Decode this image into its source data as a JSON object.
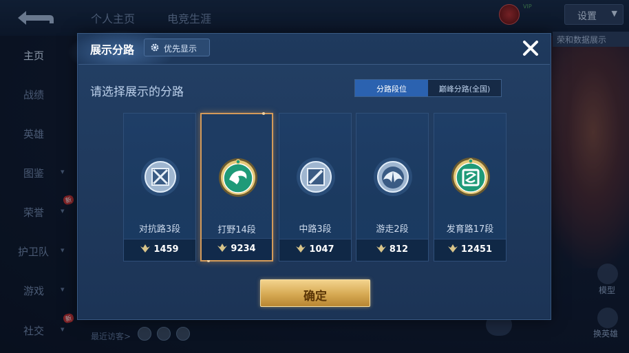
{
  "top_tabs": [
    "个人主页",
    "电竞生涯"
  ],
  "settings_label": "设置",
  "right_hint": "荣和数据展示",
  "vip_text": [
    "VIP"
  ],
  "side_menu": [
    {
      "label": "主页",
      "chevron": false,
      "new": false
    },
    {
      "label": "战绩",
      "chevron": false,
      "new": false
    },
    {
      "label": "英雄",
      "chevron": false,
      "new": false
    },
    {
      "label": "图鉴",
      "chevron": true,
      "new": false
    },
    {
      "label": "荣誉",
      "chevron": true,
      "new": true
    },
    {
      "label": "护卫队",
      "chevron": true,
      "new": false
    },
    {
      "label": "游戏",
      "chevron": true,
      "new": false
    },
    {
      "label": "社交",
      "chevron": true,
      "new": true
    }
  ],
  "new_tag": "新",
  "recent_visitors_label": "最近访客>",
  "right_controls": {
    "model": "模型",
    "swap_hero": "换英雄"
  },
  "modal": {
    "title": "展示分路",
    "priority_label": "优先显示",
    "close_icon": "close-icon",
    "subtitle": "请选择展示的分路",
    "segments": [
      "分路段位",
      "巅峰分路(全国)"
    ],
    "active_segment": 0,
    "cards": [
      {
        "name": "对抗路3段",
        "score": "1459",
        "emblem": "sword-emblem",
        "selected": false
      },
      {
        "name": "打野14段",
        "score": "9234",
        "emblem": "dragon-emblem",
        "selected": true
      },
      {
        "name": "中路3段",
        "score": "1047",
        "emblem": "staff-emblem",
        "selected": false
      },
      {
        "name": "游走2段",
        "score": "812",
        "emblem": "wings-emblem",
        "selected": false
      },
      {
        "name": "发育路17段",
        "score": "12451",
        "emblem": "bow-emblem",
        "selected": false
      }
    ],
    "confirm_label": "确定"
  },
  "colors": {
    "accent_blue": "#2b62b0",
    "selected_border": "#d39a5a",
    "confirm_gold": "#d6a953",
    "emblem_green": "#1f9a78"
  }
}
